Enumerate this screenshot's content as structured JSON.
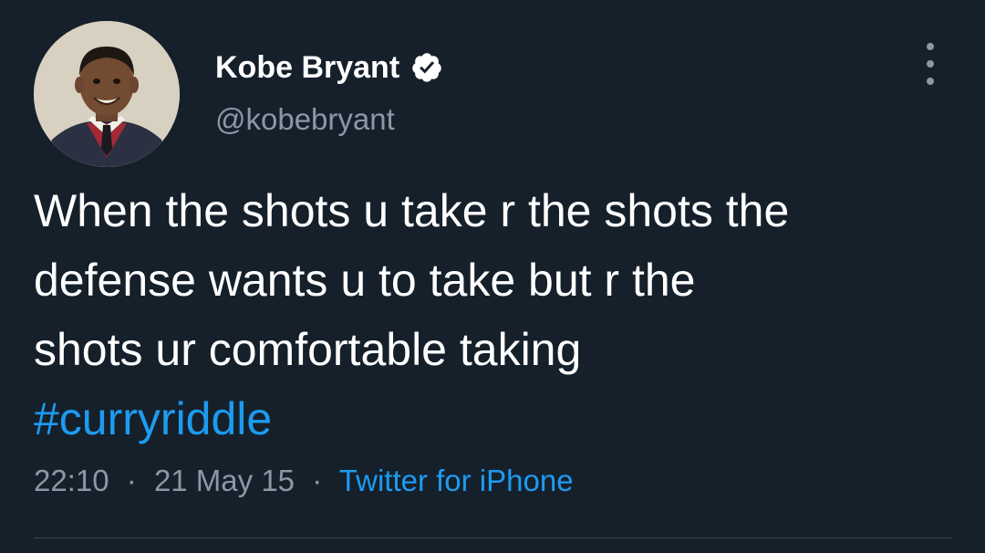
{
  "author": {
    "display_name": "Kobe Bryant",
    "handle": "@kobebryant",
    "verified": true,
    "avatar": "avatar-child-portrait"
  },
  "tweet": {
    "lines": [
      "When the shots u take r the shots the",
      "defense wants u to take but r the",
      "shots ur comfortable taking"
    ],
    "hashtag": "#curryriddle"
  },
  "meta": {
    "time": "22:10",
    "date": "21 May 15",
    "separator": "·",
    "source": "Twitter for iPhone"
  },
  "icons": {
    "verified": "verified-badge-icon",
    "more": "more-options-icon"
  },
  "colors": {
    "background": "#15202b",
    "text": "#ffffff",
    "secondary": "#8b98a5",
    "link": "#1d9bf0",
    "divider": "#38444d"
  }
}
